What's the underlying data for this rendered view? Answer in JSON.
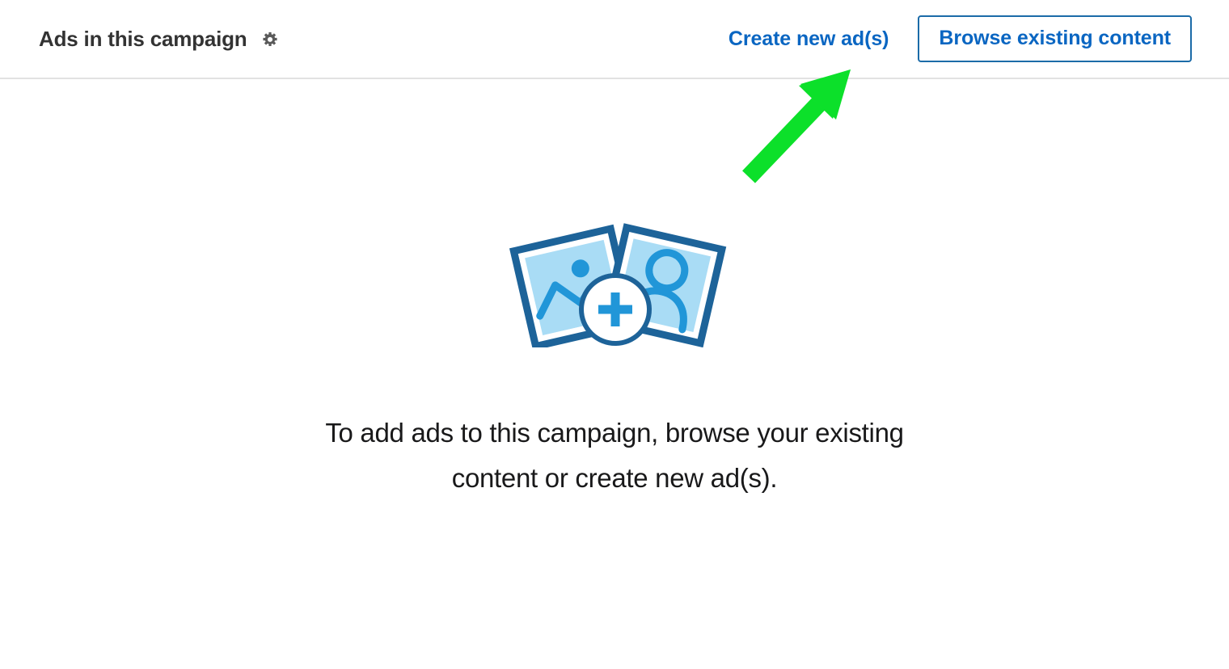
{
  "header": {
    "title": "Ads in this campaign",
    "settings_icon": "gear-icon",
    "create_label": "Create new ad(s)",
    "browse_label": "Browse existing content"
  },
  "empty_state": {
    "illustration": "two-photos-plus-icon",
    "message": "To add ads to this campaign, browse your existing content or create new ad(s)."
  },
  "annotation": {
    "arrow": "green-pointer-arrow",
    "points_to": "Browse existing content"
  },
  "colors": {
    "link_blue": "#0a66c2",
    "button_border": "#1b6ba8",
    "divider": "#e2e2e2",
    "title_text": "#333333",
    "body_text": "#19191a",
    "gear_gray": "#5a5a5a",
    "illustration_dark_blue": "#1d6399",
    "illustration_light_blue": "#a9dcf5",
    "illustration_mid_blue": "#2196d8",
    "annotation_green": "#0ce02a"
  }
}
